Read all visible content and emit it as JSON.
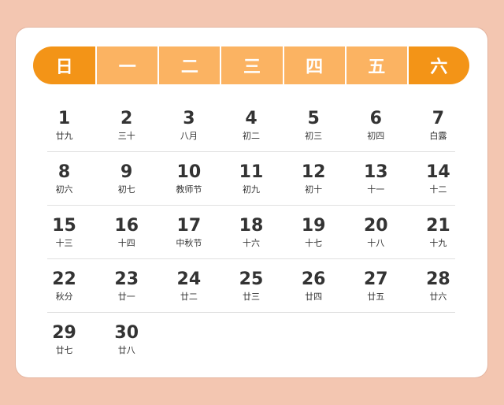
{
  "weekdays": [
    "日",
    "一",
    "二",
    "三",
    "四",
    "五",
    "六"
  ],
  "weeks": [
    [
      {
        "day": "1",
        "lunar": "廿九"
      },
      {
        "day": "2",
        "lunar": "三十"
      },
      {
        "day": "3",
        "lunar": "八月"
      },
      {
        "day": "4",
        "lunar": "初二"
      },
      {
        "day": "5",
        "lunar": "初三"
      },
      {
        "day": "6",
        "lunar": "初四"
      },
      {
        "day": "7",
        "lunar": "白露"
      }
    ],
    [
      {
        "day": "8",
        "lunar": "初六"
      },
      {
        "day": "9",
        "lunar": "初七"
      },
      {
        "day": "10",
        "lunar": "教师节"
      },
      {
        "day": "11",
        "lunar": "初九"
      },
      {
        "day": "12",
        "lunar": "初十"
      },
      {
        "day": "13",
        "lunar": "十一"
      },
      {
        "day": "14",
        "lunar": "十二"
      }
    ],
    [
      {
        "day": "15",
        "lunar": "十三"
      },
      {
        "day": "16",
        "lunar": "十四"
      },
      {
        "day": "17",
        "lunar": "中秋节"
      },
      {
        "day": "18",
        "lunar": "十六"
      },
      {
        "day": "19",
        "lunar": "十七"
      },
      {
        "day": "20",
        "lunar": "十八"
      },
      {
        "day": "21",
        "lunar": "十九"
      }
    ],
    [
      {
        "day": "22",
        "lunar": "秋分"
      },
      {
        "day": "23",
        "lunar": "廿一"
      },
      {
        "day": "24",
        "lunar": "廿二"
      },
      {
        "day": "25",
        "lunar": "廿三"
      },
      {
        "day": "26",
        "lunar": "廿四"
      },
      {
        "day": "27",
        "lunar": "廿五"
      },
      {
        "day": "28",
        "lunar": "廿六"
      }
    ],
    [
      {
        "day": "29",
        "lunar": "廿七"
      },
      {
        "day": "30",
        "lunar": "廿八"
      }
    ]
  ],
  "colors": {
    "background": "#f3c6b1",
    "weekend_header": "#f39417",
    "weekday_header": "#fbb362",
    "text": "#333333"
  }
}
